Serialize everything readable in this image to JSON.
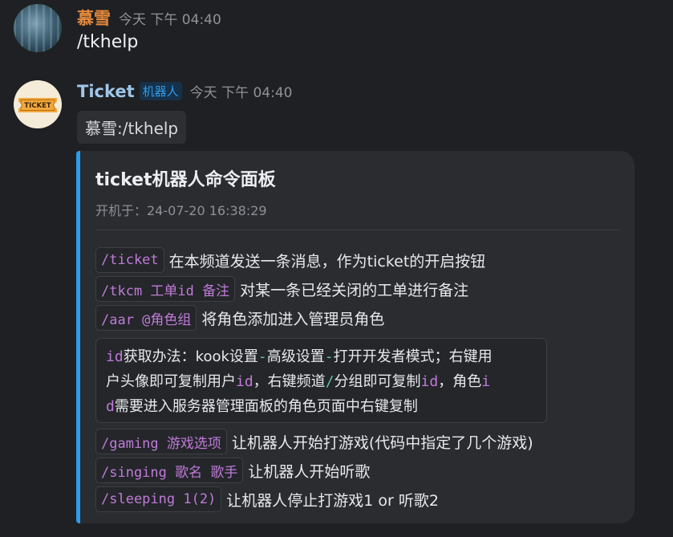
{
  "user_message": {
    "avatar_icon": "user-avatar",
    "username": "慕雪",
    "timestamp": "今天 下午 04:40",
    "text": "/tkhelp"
  },
  "bot_message": {
    "avatar_icon": "ticket-avatar",
    "avatar_logo_text": "TICKET",
    "username": "Ticket",
    "badge": "机器人",
    "timestamp": "今天 下午 04:40",
    "quote": "慕雪:/tkhelp",
    "card": {
      "accent_color": "#2b9bee",
      "title": "ticket机器人命令面板",
      "subtitle": "开机于：24-07-20 16:38:29",
      "commands": [
        {
          "code": "/ticket",
          "desc": "在本频道发送一条消息，作为ticket的开启按钮"
        },
        {
          "code": "/tkcm 工单id 备注",
          "desc": "对某一条已经关闭的工单进行备注"
        },
        {
          "code": "/aar @角色组",
          "desc": "将角色添加进入管理员角色"
        }
      ],
      "note": {
        "line1": {
          "a": "id",
          "b": "获取办法：kook设置",
          "c": "-",
          "d": "高级设置",
          "e": "-",
          "f": "打开开发者模式；右键用"
        },
        "line2": {
          "a": "户头像即可复制用户",
          "b": "id",
          "c": "，右键频道",
          "d": "/",
          "e": "分组即可复制",
          "f": "id",
          "g": "，角色",
          "h": "i"
        },
        "line3": {
          "a": "d",
          "b": "需要进入服务器管理面板的角色页面中右键复制"
        }
      },
      "commands2": [
        {
          "code": "/gaming 游戏选项",
          "desc": "让机器人开始打游戏(代码中指定了几个游戏)"
        },
        {
          "code": "/singing 歌名 歌手",
          "desc": "让机器人开始听歌"
        },
        {
          "code": "/sleeping 1(2)",
          "desc": "让机器人停止打游戏1 or 听歌2"
        }
      ]
    }
  }
}
